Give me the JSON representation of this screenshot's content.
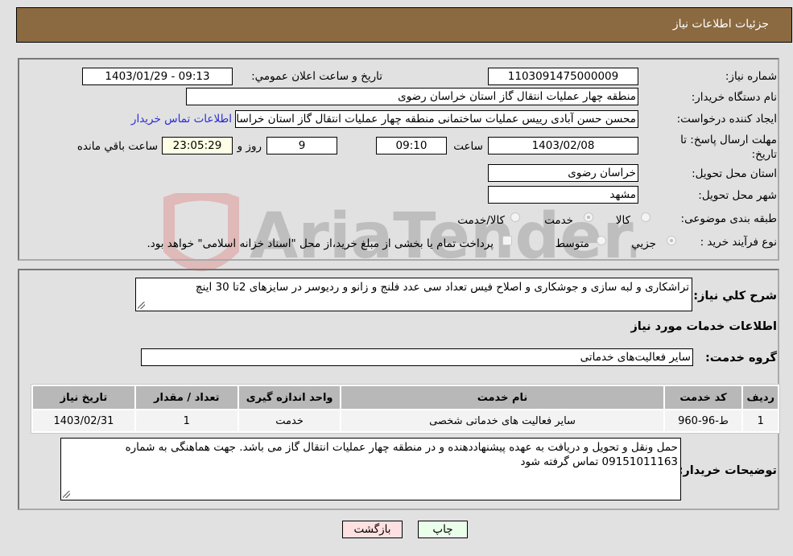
{
  "header": {
    "title": "جزئیات اطلاعات نیاز"
  },
  "form": {
    "need_number": {
      "label": "شماره نیاز:",
      "value": "1103091475000009"
    },
    "announce_datetime": {
      "label": "تاریخ و ساعت اعلان عمومي:",
      "value": "1403/01/29 - 09:13"
    },
    "buyer_org": {
      "label": "نام دستگاه خریدار:",
      "value": "منطقه چهار عملیات انتقال گاز   استان خراسان رضوی"
    },
    "creator": {
      "label": "ایجاد کننده درخواست:",
      "value": "محسن حسن آبادی رییس عملیات ساختمانی منطقه چهار عملیات انتقال گاز   استان خراسان رضوی",
      "contact_link": "اطلاعات تماس خریدار"
    },
    "deadline": {
      "label": "مهلت ارسال پاسخ: تا تاریخ:",
      "date": "1403/02/08",
      "time_label": "ساعت",
      "time": "09:10",
      "days": "9",
      "days_label": "روز و",
      "remaining": "23:05:29",
      "remaining_label": "ساعت باقي مانده"
    },
    "delivery_province": {
      "label": "استان محل تحویل:",
      "value": "خراسان رضوی"
    },
    "delivery_city": {
      "label": "شهر محل تحویل:",
      "value": "مشهد"
    },
    "category": {
      "label": "طبقه بندی موضوعی:",
      "options": [
        "کالا",
        "خدمت",
        "کالا/خدمت"
      ],
      "selected": "خدمت"
    },
    "purchase_process": {
      "label": "نوع فرآیند خرید :",
      "options": [
        "جزیي",
        "متوسط"
      ],
      "selected": "جزیي",
      "treasury_note": "پرداخت تمام یا بخشی از مبلغ خرید،از محل \"اسناد خزانه اسلامی\" خواهد بود."
    }
  },
  "description": {
    "label": "شرح کلي نیاز:",
    "value": "تراشکاری و لبه سازی و جوشکاری و اصلاح فیس تعداد سی عدد فلنج و زانو و ردیوسر در سایزهای 2تا 30 اینچ"
  },
  "services": {
    "section_title": "اطلاعات خدمات مورد نیاز",
    "group_label": "گروه خدمت:",
    "group_value": "سایر فعالیت‌های خدماتی",
    "columns": [
      "ردیف",
      "کد خدمت",
      "نام خدمت",
      "واحد اندازه گیری",
      "تعداد / مقدار",
      "تاریخ نیاز"
    ],
    "rows": [
      [
        "1",
        "ط-96-960",
        "سایر فعالیت های خدماتی شخصی",
        "خدمت",
        "1",
        "1403/02/31"
      ]
    ]
  },
  "buyer_notes": {
    "label": "توضیحات خریدار:",
    "value": "حمل ونقل و تحویل و دریافت به عهده پیشنهاددهنده و در منطقه چهار عملیات انتقال گاز می باشد. جهت هماهنگی به شماره 09151011163 تماس گرفته شود"
  },
  "buttons": {
    "print": "چاپ",
    "back": "بازگشت"
  },
  "watermark": {
    "text": "AriaTender.neT"
  },
  "colors": {
    "header": "#8b6a41",
    "link": "#2b2bd8",
    "print_bg": "#eaffea",
    "back_bg": "#ffe0e0"
  }
}
